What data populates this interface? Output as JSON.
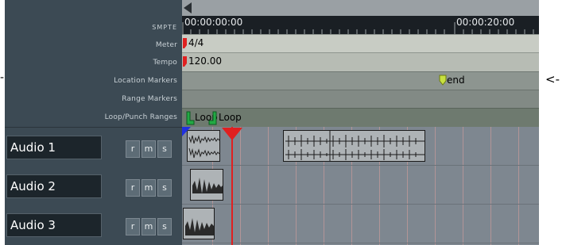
{
  "rulers": {
    "smpte_label": "SMPTE",
    "meter_label": "Meter",
    "tempo_label": "Tempo",
    "location_markers_label": "Location Markers",
    "range_markers_label": "Range Markers",
    "loop_punch_label": "Loop/Punch Ranges",
    "timecode_start": "00:00:00:00",
    "timecode_20": "00:00:20:00",
    "meter_value": "4/4",
    "tempo_value": "120.00",
    "end_marker": "end",
    "loop_label_1": "Loop",
    "loop_label_2": "Loop"
  },
  "tracks": [
    {
      "name": "Audio 1",
      "rec": "r",
      "mute": "m",
      "solo": "s"
    },
    {
      "name": "Audio 2",
      "rec": "r",
      "mute": "m",
      "solo": "s"
    },
    {
      "name": "Audio 3",
      "rec": "r",
      "mute": "m",
      "solo": "s"
    }
  ],
  "nav": {
    "left_arrow": "-",
    "right_arrow": "<-"
  },
  "colors": {
    "header_bg": "#3c4a54",
    "ruler_bg": "#c8ccc4",
    "track_bg": "#7e8790",
    "playhead": "#e02020",
    "marker": "#c8e040",
    "loop_marker": "#22aa44",
    "region_bg": "#aeb3b6"
  }
}
